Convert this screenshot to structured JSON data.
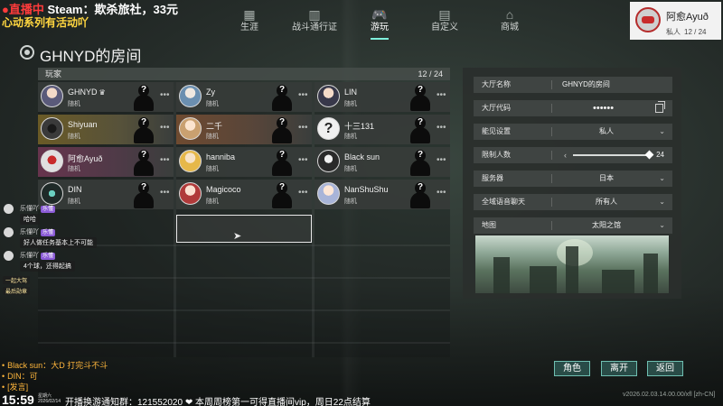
{
  "overlay": {
    "live_label": "●直播中",
    "game_line": " Steam：欺杀旅社，33元",
    "activity_line": "心动系列有活动吖"
  },
  "nav": {
    "tabs": [
      {
        "label": "生涯",
        "icon": "bar-chart-icon",
        "glyph": "▦"
      },
      {
        "label": "战斗通行证",
        "icon": "battle-pass-icon",
        "glyph": "▥"
      },
      {
        "label": "游玩",
        "icon": "gamepad-icon",
        "glyph": "🎮"
      },
      {
        "label": "自定义",
        "icon": "wardrobe-icon",
        "glyph": "▤"
      },
      {
        "label": "商城",
        "icon": "shop-icon",
        "glyph": "⌂"
      }
    ],
    "active_tab": "游玩"
  },
  "profile": {
    "name": "阿愈Ayuð",
    "privacy": "私人",
    "count": "12 / 24"
  },
  "room": {
    "title": "GHNYD的房间"
  },
  "players": {
    "header_label": "玩家",
    "count": "12 / 24",
    "random_label": "随机",
    "list": [
      {
        "name": "GHNYD",
        "host": true
      },
      {
        "name": "Zy",
        "host": false
      },
      {
        "name": "LIN",
        "host": false
      },
      {
        "name": "Shiyuan",
        "host": false
      },
      {
        "name": "二千",
        "host": false
      },
      {
        "name": "十三131",
        "host": false
      },
      {
        "name": "阿愈Ayuð",
        "host": false
      },
      {
        "name": "hanniba",
        "host": false
      },
      {
        "name": "Black sun",
        "host": false
      },
      {
        "name": "DIN",
        "host": false
      },
      {
        "name": "Magicoco",
        "host": false
      },
      {
        "name": "NanShuShu",
        "host": false
      }
    ],
    "crown_glyph": "♛",
    "question_glyph": "?",
    "more_glyph": "•••"
  },
  "settings": {
    "lobby_name_label": "大厅名称",
    "lobby_name_value": "GHNYD的房间",
    "lobby_code_label": "大厅代码",
    "lobby_code_value": "••••••",
    "visibility_label": "能见设置",
    "visibility_value": "私人",
    "player_limit_label": "限制人数",
    "player_limit_value": "24",
    "player_limit_fraction": 0.96,
    "server_label": "服务器",
    "server_value": "日本",
    "voice_chat_label": "全域语音聊天",
    "voice_chat_value": "所有人",
    "map_label": "地图",
    "map_value": "太阳之馆",
    "chevron_glyph": "⌄",
    "prev_glyph": "‹"
  },
  "buttons": {
    "role": "角色",
    "leave": "离开",
    "back": "返回"
  },
  "version": "v2026.02.03.14.00.00/xfl [zh-CN]",
  "chat_overlay": {
    "entries": [
      {
        "name": "乐懂吖",
        "msg": "哈哈"
      },
      {
        "name": "乐懂吖",
        "msg": "好人做任务基本上不可能"
      },
      {
        "name": "乐懂吖",
        "msg": "4个球，还得起搞"
      }
    ],
    "tags": [
      "一起大驾",
      "最后勋章"
    ],
    "badge_text": "乐懂"
  },
  "danmu": [
    {
      "who": "Black sun：",
      "what": "大D 打完斗不斗"
    },
    {
      "who": "DIN：",
      "what": "可"
    },
    {
      "who": "[发言]",
      "what": ""
    }
  ],
  "ticker": {
    "clock": "15:59",
    "clock_sub": "星期六",
    "clock_date": "2026/02/14",
    "text": "开播换游通知群：121552020 ❤ 本周周榜第一可得直播间vip，周日22点结算"
  }
}
